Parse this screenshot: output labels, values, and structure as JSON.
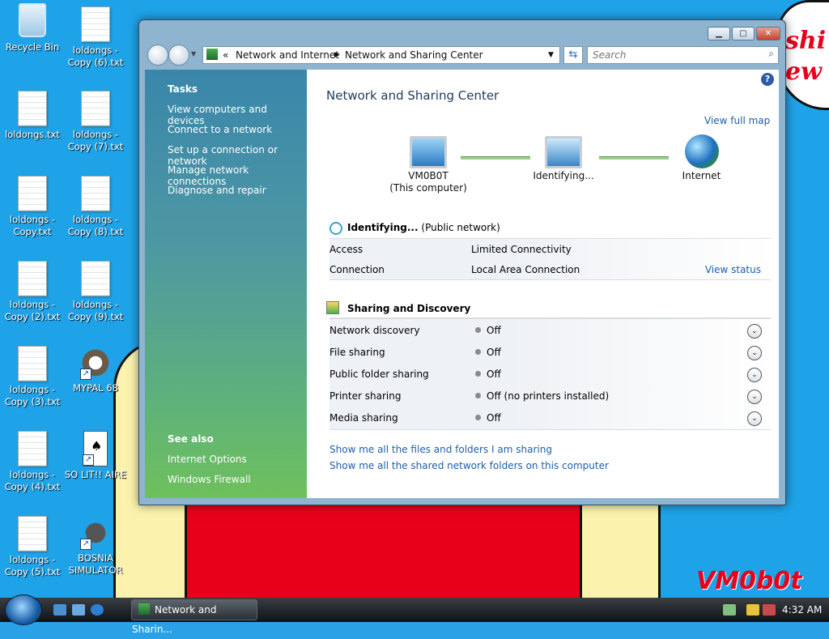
{
  "desktop": {
    "icons": [
      {
        "label": "Recycle Bin"
      },
      {
        "label": "loldongs - Copy (6).txt"
      },
      {
        "label": "loldongs.txt"
      },
      {
        "label": "loldongs - Copy (7).txt"
      },
      {
        "label": "loldongs - Copy.txt"
      },
      {
        "label": "loldongs - Copy (8).txt"
      },
      {
        "label": "loldongs - Copy (2).txt"
      },
      {
        "label": "loldongs - Copy (9).txt"
      },
      {
        "label": "loldongs - Copy (3).txt"
      },
      {
        "label": "MYPAL 68"
      },
      {
        "label": "loldongs - Copy (4).txt"
      },
      {
        "label": "SO LIT!! AIRE"
      },
      {
        "label": "loldongs - Copy (5).txt"
      },
      {
        "label": "BOSNIA SIMULATOR"
      }
    ],
    "speech_text": "shi\new",
    "watermark": "VM0b0t"
  },
  "window": {
    "breadcrumb": {
      "chev": "«",
      "part1": "Network and Internet",
      "part2": "Network and Sharing Center"
    },
    "search_placeholder": "Search",
    "sidebar": {
      "tasks_header": "Tasks",
      "tasks": [
        "View computers and devices",
        "Connect to a network",
        "Set up a connection or network",
        "Manage network connections",
        "Diagnose and repair"
      ],
      "see_also_header": "See also",
      "see_also": [
        "Internet Options",
        "Windows Firewall"
      ]
    },
    "main": {
      "title": "Network and Sharing Center",
      "view_full_map": "View full map",
      "map": {
        "computer_name": "VM0B0T",
        "computer_sub": "(This computer)",
        "network_label": "Identifying...",
        "internet_label": "Internet"
      },
      "network": {
        "name": "Identifying...",
        "type": "(Public network)",
        "access_label": "Access",
        "access_value": "Limited Connectivity",
        "connection_label": "Connection",
        "connection_value": "Local Area Connection",
        "view_status": "View status"
      },
      "sharing": {
        "header": "Sharing and Discovery",
        "rows": [
          {
            "label": "Network discovery",
            "value": "Off"
          },
          {
            "label": "File sharing",
            "value": "Off"
          },
          {
            "label": "Public folder sharing",
            "value": "Off"
          },
          {
            "label": "Printer sharing",
            "value": "Off (no printers installed)"
          },
          {
            "label": "Media sharing",
            "value": "Off"
          }
        ],
        "link1": "Show me all the files and folders I am sharing",
        "link2": "Show me all the shared network folders on this computer"
      }
    }
  },
  "taskbar": {
    "task_label": "Network and Sharin...",
    "clock": "4:32 AM"
  }
}
